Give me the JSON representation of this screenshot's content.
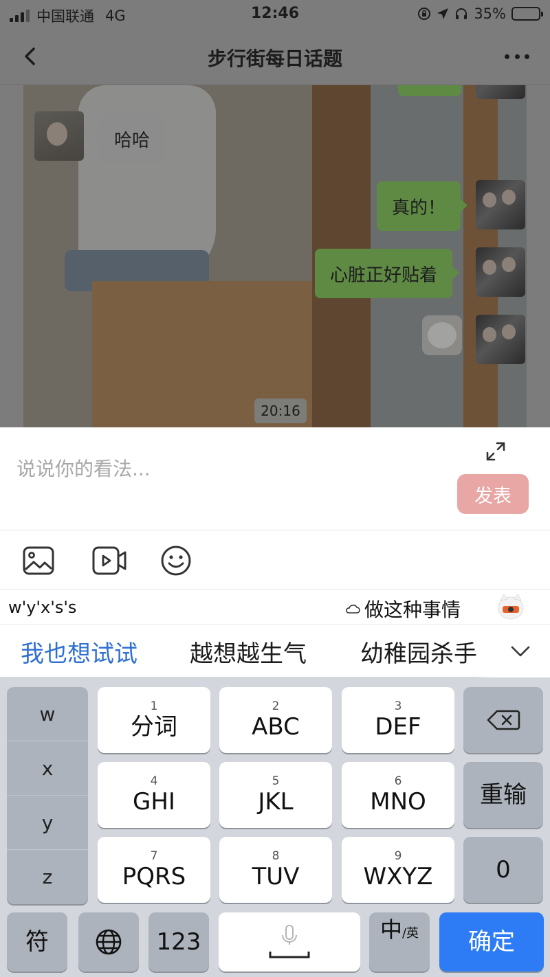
{
  "status_bar": {
    "carrier": "中国联通",
    "network": "4G",
    "time": "12:46",
    "battery_percent": "35%",
    "battery_level": 0.35
  },
  "nav": {
    "title": "步行街每日话题",
    "back_icon": "chevron-left-icon",
    "more_icon": "more-dots-icon"
  },
  "post_image": {
    "chat_left_bubble": "哈哈",
    "chat_right_bubble_1": "真的！",
    "chat_right_bubble_2": "心脏正好贴着",
    "video_duration": "20:16"
  },
  "comment": {
    "placeholder": "说说你的看法...",
    "value": "",
    "submit_label": "发表",
    "submit_color": "#e8a6a4"
  },
  "attachments": {
    "icons": [
      "image-icon",
      "video-icon",
      "emoji-icon"
    ]
  },
  "ime": {
    "pinyin": "w'y'x's's",
    "cloud_suggestion": "做这种事情",
    "candidates": [
      "我也想试试",
      "越想越生气",
      "幼稚园杀手"
    ],
    "highlight_color": "#2f6fd2",
    "pinyin_options": [
      "w",
      "x",
      "y",
      "z"
    ],
    "keys": {
      "k1": {
        "num": "1",
        "label": "分词"
      },
      "k2": {
        "num": "2",
        "label": "ABC"
      },
      "k3": {
        "num": "3",
        "label": "DEF"
      },
      "k4": {
        "num": "4",
        "label": "GHI"
      },
      "k5": {
        "num": "5",
        "label": "JKL"
      },
      "k6": {
        "num": "6",
        "label": "MNO"
      },
      "k7": {
        "num": "7",
        "label": "PQRS"
      },
      "k8": {
        "num": "8",
        "label": "TUV"
      },
      "k9": {
        "num": "9",
        "label": "WXYZ"
      },
      "retype": "重输",
      "zero": "0",
      "symbol": "符",
      "numbers": "123",
      "lang_main": "中",
      "lang_sub": "/英",
      "confirm": "确定",
      "confirm_color": "#2d7cf5"
    }
  }
}
